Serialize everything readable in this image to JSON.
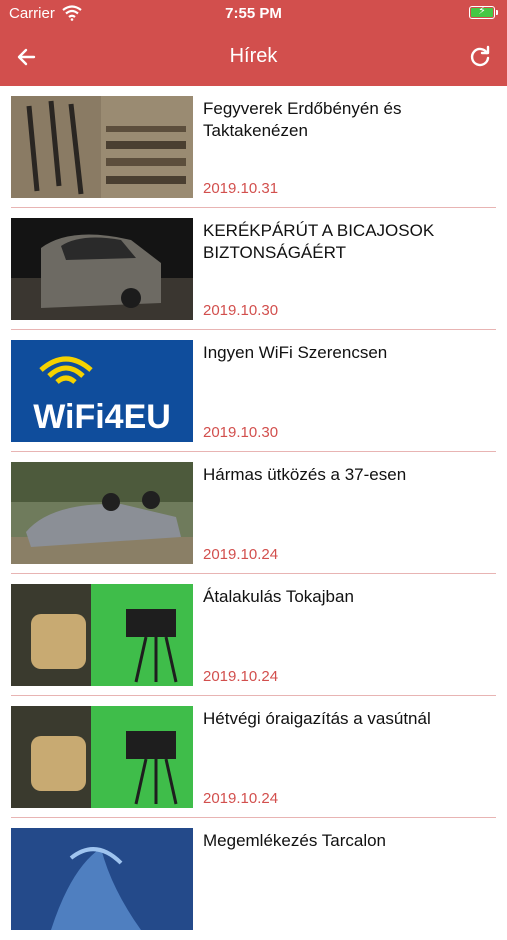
{
  "status_bar": {
    "carrier": "Carrier",
    "time": "7:55 PM",
    "battery": "charging"
  },
  "nav": {
    "title": "Hírek",
    "back_icon": "arrow-left-icon",
    "refresh_icon": "refresh-icon"
  },
  "colors": {
    "accent": "#d24f4d",
    "date": "#d24f4d",
    "separator": "#e8b4b3"
  },
  "news": [
    {
      "title": "Fegyverek Erdőbényén és Taktakenézen",
      "date": "2019.10.31",
      "thumbnail": "weapons-photo"
    },
    {
      "title": "KERÉKPÁRÚT A BICAJOSOK BIZTONSÁGÁÉRT",
      "date": "2019.10.30",
      "thumbnail": "crashed-car-photo"
    },
    {
      "title": "Ingyen WiFi Szerencsen",
      "date": "2019.10.30",
      "thumbnail": "wifi4eu-logo",
      "thumbnail_text": "WiFi4EU"
    },
    {
      "title": "Hármas ütközés a 37-esen",
      "date": "2019.10.24",
      "thumbnail": "overturned-car-photo"
    },
    {
      "title": "Átalakulás Tokajban",
      "date": "2019.10.24",
      "thumbnail": "studio-camera-photo"
    },
    {
      "title": "Hétvégi óraigazítás a vasútnál",
      "date": "2019.10.24",
      "thumbnail": "studio-camera-photo"
    },
    {
      "title": "Megemlékezés Tarcalon",
      "date": "",
      "thumbnail": "blue-sculpture-photo"
    }
  ]
}
